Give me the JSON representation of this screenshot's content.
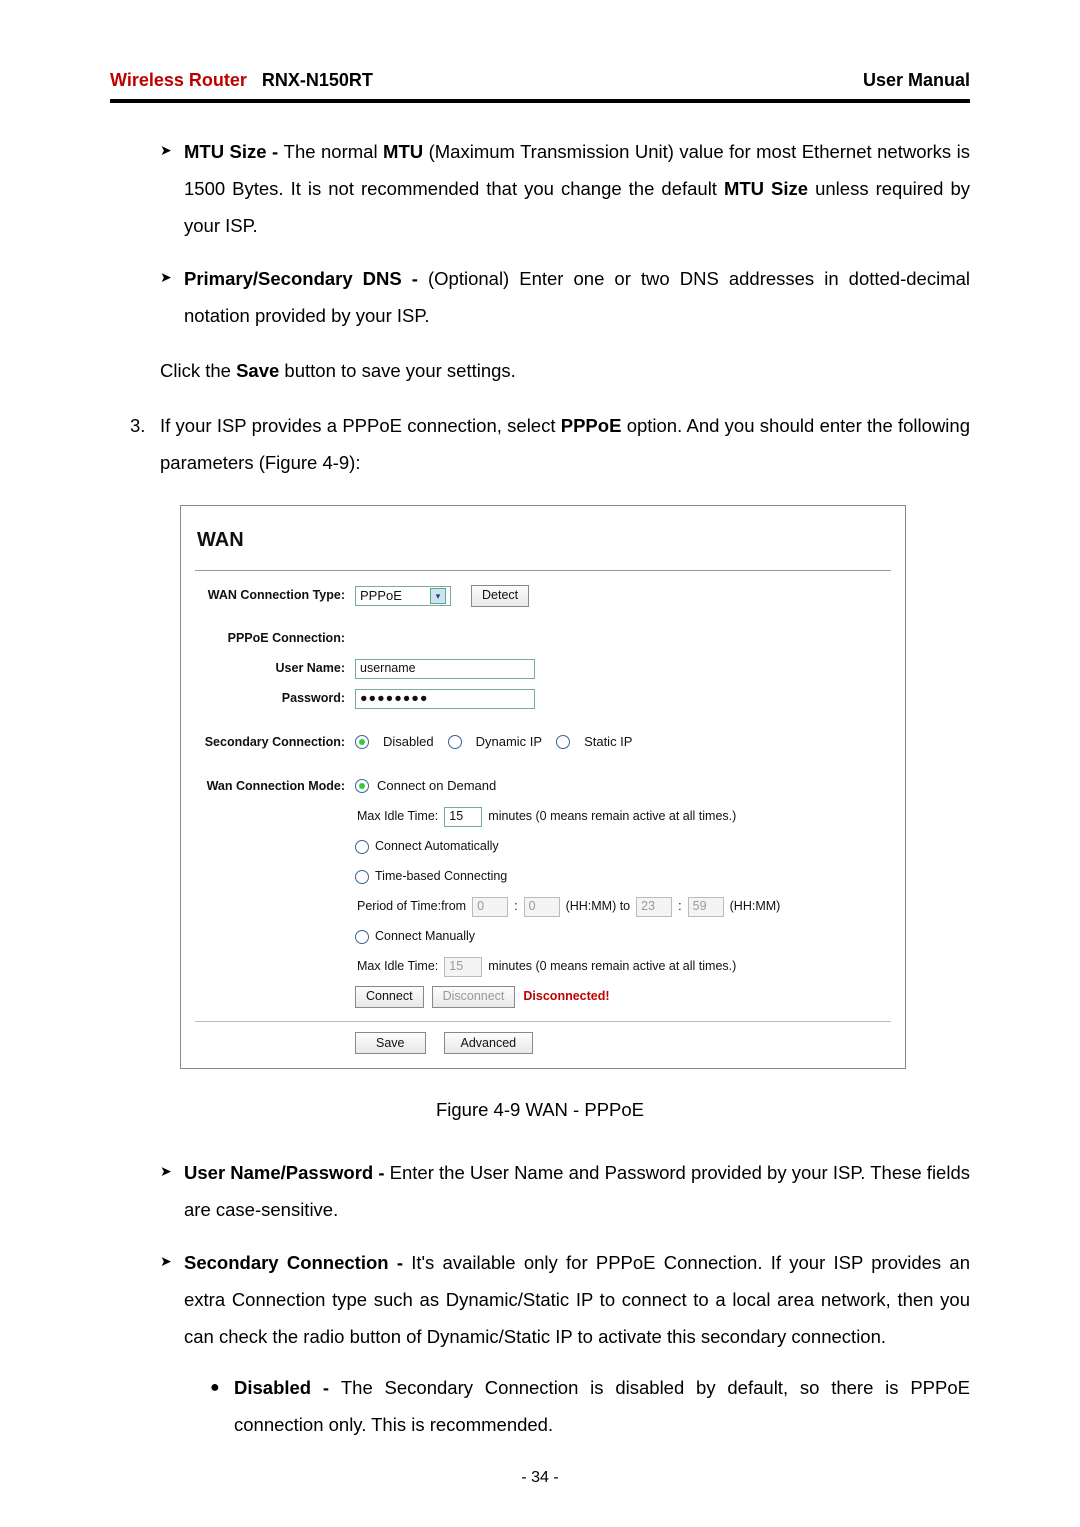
{
  "header": {
    "brand": "Wireless Router",
    "model": "RNX-N150RT",
    "right": "User Manual"
  },
  "para": {
    "mtu_label": "MTU Size - ",
    "mtu_text1": "The normal ",
    "mtu_bold1": "MTU",
    "mtu_text2": " (Maximum Transmission Unit) value for most Ethernet networks is 1500 Bytes. It is not recommended that you change the default ",
    "mtu_bold2": "MTU Size",
    "mtu_text3": " unless required by your ISP.",
    "dns_label": "Primary/Secondary DNS - ",
    "dns_text": "(Optional) Enter one or two DNS addresses in dotted-decimal notation provided by your ISP.",
    "save_line_a": "Click the ",
    "save_bold": "Save",
    "save_line_b": " button to save your settings.",
    "step3_num": "3.",
    "step3_a": "If your ISP provides a PPPoE connection, select ",
    "step3_bold": "PPPoE",
    "step3_b": " option. And you should enter the following parameters (Figure 4-9):",
    "fig_caption": "Figure 4-9    WAN - PPPoE",
    "userpw_label": "User Name/Password - ",
    "userpw_text": "Enter the User Name and Password provided by your ISP. These fields are case-sensitive.",
    "secconn_label": "Secondary Connection - ",
    "secconn_text": "It's available only for PPPoE Connection. If your ISP provides an extra Connection type such as Dynamic/Static IP to connect to a local area network, then you can check the radio button of Dynamic/Static IP to activate this secondary connection.",
    "disabled_label": "Disabled - ",
    "disabled_text": "The Secondary Connection is disabled by default, so there is PPPoE connection only. This is recommended."
  },
  "figure": {
    "title": "WAN",
    "wan_type_lbl": "WAN Connection Type:",
    "wan_type_val": "PPPoE",
    "detect_btn": "Detect",
    "pppoe_lbl": "PPPoE Connection:",
    "user_lbl": "User Name:",
    "user_val": "username",
    "pw_lbl": "Password:",
    "pw_val": "●●●●●●●●",
    "sec_lbl": "Secondary Connection:",
    "sec_opt_disabled": "Disabled",
    "sec_opt_dynamic": "Dynamic IP",
    "sec_opt_static": "Static IP",
    "mode_lbl": "Wan Connection Mode:",
    "mode_demand": "Connect on Demand",
    "mode_auto": "Connect Automatically",
    "mode_time": "Time-based Connecting",
    "mode_manual": "Connect Manually",
    "max_idle_lbl": "Max Idle Time:",
    "max_idle_val1": "15",
    "max_idle_val2": "15",
    "max_idle_suffix": "minutes (0 means remain active at all times.)",
    "period_lbl": "Period of Time:from",
    "period_h1": "0",
    "period_m1": "0",
    "period_hhmm_to": "(HH:MM) to",
    "period_h2": "23",
    "period_m2": "59",
    "period_hhmm": "(HH:MM)",
    "connect_btn": "Connect",
    "disconnect_btn": "Disconnect",
    "status": "Disconnected!",
    "save_btn": "Save",
    "adv_btn": "Advanced"
  },
  "page_num": "- 34 -"
}
